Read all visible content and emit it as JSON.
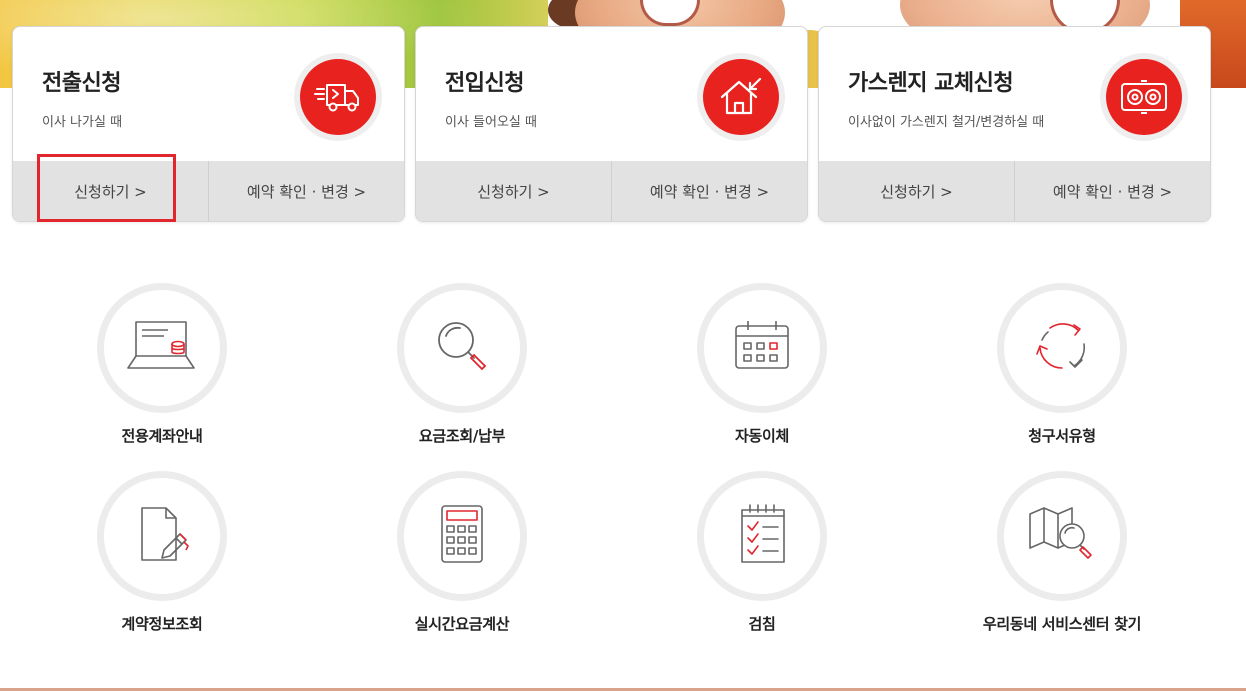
{
  "cards": [
    {
      "title": "전출신청",
      "desc": "이사 나가실 때",
      "icon": "moving-truck-icon",
      "apply_label": "신청하기 >",
      "reservation_label": "예약 확인 · 변경 >"
    },
    {
      "title": "전입신청",
      "desc": "이사 들어오실 때",
      "icon": "house-arrow-icon",
      "apply_label": "신청하기 >",
      "reservation_label": "예약 확인 · 변경 >"
    },
    {
      "title": "가스렌지 교체신청",
      "desc": "이사없이 가스렌지 철거/변경하실 때",
      "icon": "gas-stove-icon",
      "apply_label": "신청하기 >",
      "reservation_label": "예약 확인 · 변경 >"
    }
  ],
  "services": [
    {
      "label": "전용계좌안내",
      "icon": "laptop-coins-icon"
    },
    {
      "label": "요금조회/납부",
      "icon": "magnifier-icon"
    },
    {
      "label": "자동이체",
      "icon": "calendar-icon"
    },
    {
      "label": "청구서유형",
      "icon": "refresh-cycle-icon"
    },
    {
      "label": "계약정보조회",
      "icon": "document-pen-icon"
    },
    {
      "label": "실시간요금계산",
      "icon": "calculator-icon"
    },
    {
      "label": "검침",
      "icon": "checklist-icon"
    },
    {
      "label": "우리동네 서비스센터 찾기",
      "icon": "map-search-icon"
    }
  ],
  "colors": {
    "accent_red": "#e8231f",
    "highlight_red": "#e2262e",
    "button_bg": "#e2e2e2",
    "ring_gray": "#ececec"
  }
}
